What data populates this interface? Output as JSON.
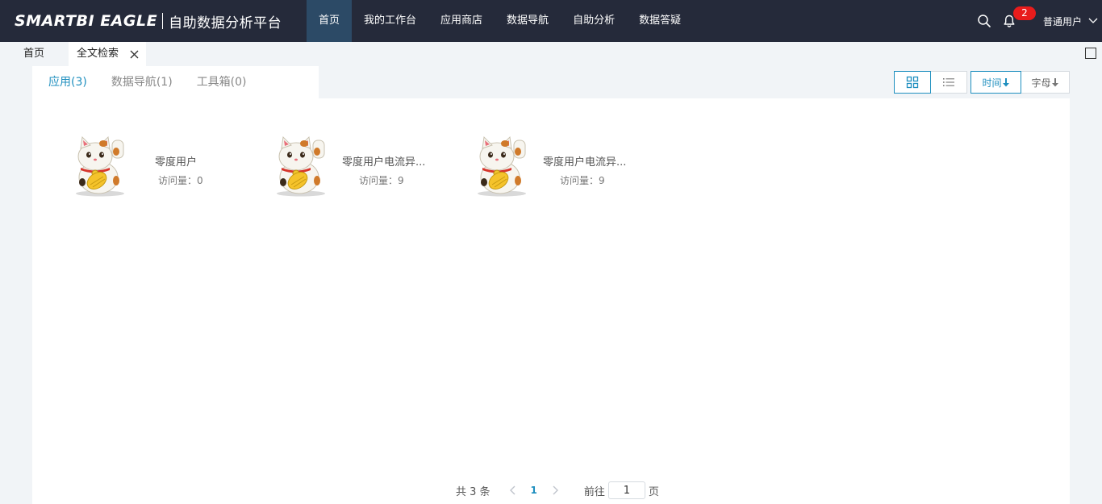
{
  "header": {
    "logo_text": "SMARTBI EAGLE",
    "logo_subtitle": "自助数据分析平台",
    "nav": [
      {
        "label": "首页",
        "active": true
      },
      {
        "label": "我的工作台",
        "active": false
      },
      {
        "label": "应用商店",
        "active": false
      },
      {
        "label": "数据导航",
        "active": false
      },
      {
        "label": "自助分析",
        "active": false
      },
      {
        "label": "数据答疑",
        "active": false
      }
    ],
    "notification_count": "2",
    "user_name": "普通用户"
  },
  "tabs": {
    "home_label": "首页",
    "search_label": "全文检索"
  },
  "subtabs": [
    {
      "label": "应用(3)",
      "active": true
    },
    {
      "label": "数据导航(1)",
      "active": false
    },
    {
      "label": "工具箱(0)",
      "active": false
    }
  ],
  "sort": {
    "time_label": "时间",
    "alpha_label": "字母"
  },
  "cards": [
    {
      "title": "零度用户",
      "visits": "访问量：0"
    },
    {
      "title": "零度用户电流异...",
      "visits": "访问量：9"
    },
    {
      "title": "零度用户电流异...",
      "visits": "访问量：9"
    }
  ],
  "pagination": {
    "total": "共 3 条",
    "current_page": "1",
    "goto_label": "前往",
    "goto_value": "1",
    "page_suffix": "页"
  },
  "colors": {
    "header_bg": "#252a3a",
    "nav_active": "#2c4a66",
    "accent": "#1f8fbf",
    "badge": "#e81c1c"
  }
}
